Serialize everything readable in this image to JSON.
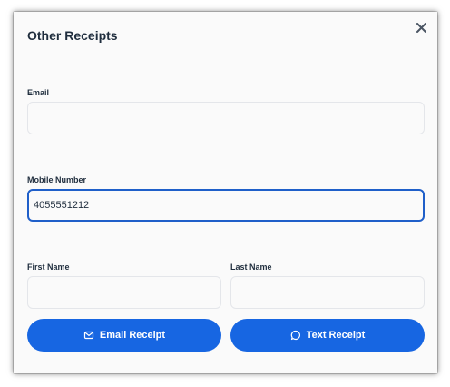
{
  "modal": {
    "title": "Other Receipts",
    "close_icon": "close-icon"
  },
  "form": {
    "email": {
      "label": "Email",
      "value": "",
      "placeholder": ""
    },
    "mobile": {
      "label": "Mobile Number",
      "value": "4055551212",
      "placeholder": ""
    },
    "first_name": {
      "label": "First Name",
      "value": "",
      "placeholder": ""
    },
    "last_name": {
      "label": "Last Name",
      "value": "",
      "placeholder": ""
    }
  },
  "actions": {
    "email_receipt": {
      "label": "Email Receipt",
      "icon": "envelope-icon"
    },
    "text_receipt": {
      "label": "Text Receipt",
      "icon": "chat-bubble-icon"
    }
  },
  "colors": {
    "primary": "#1766e2",
    "focus_border": "#1f5fc9",
    "text": "#1f2d3d",
    "field_border": "#e4e6ea",
    "background": "#fafafa"
  }
}
